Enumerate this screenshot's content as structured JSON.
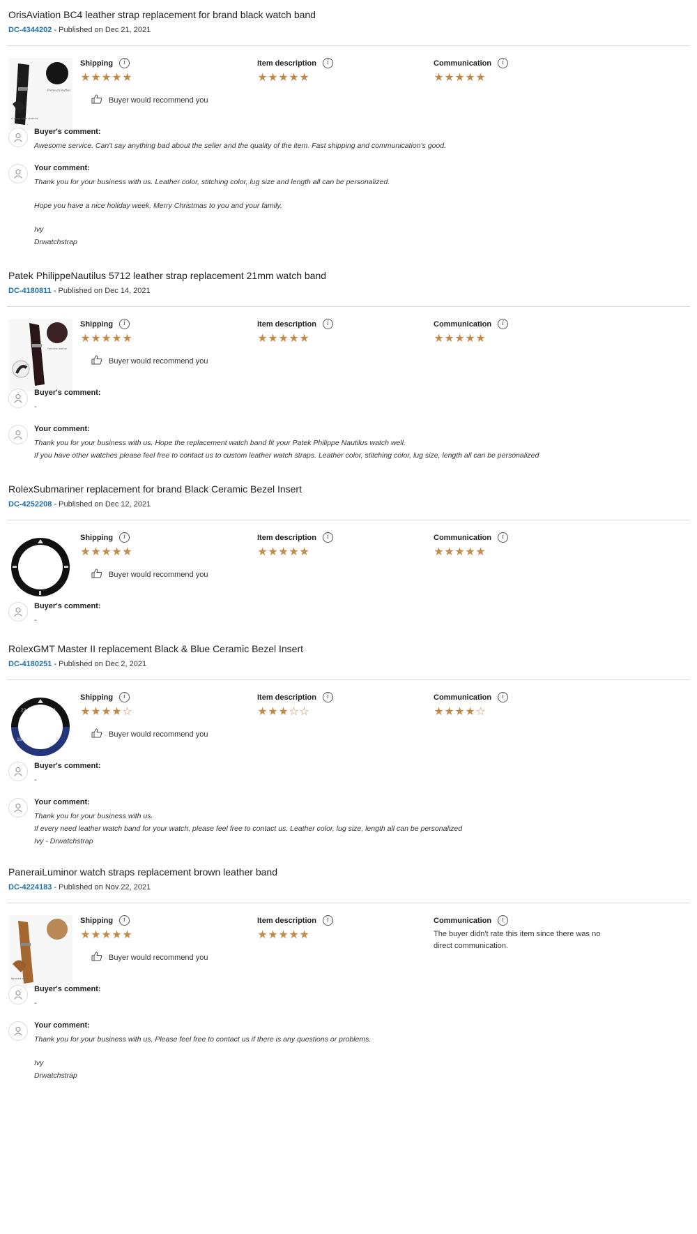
{
  "labels": {
    "shipping": "Shipping",
    "item_description": "Item description",
    "communication": "Communication",
    "buyer_recommend": "Buyer would recommend you",
    "buyer_comment": "Buyer's comment:",
    "your_comment": "Your comment:",
    "published_prefix": " - Published on "
  },
  "colors": {
    "star": "#c48a4a",
    "order_id": "#1f6fa8"
  },
  "reviews": [
    {
      "title": "OrisAviation BC4 leather strap replacement for brand black watch band",
      "order_id": "DC-4344202",
      "date": "Dec 21, 2021",
      "thumbnail": "black-leather-strap-image",
      "ratings": {
        "shipping": 5,
        "item_description": 5,
        "communication": 5
      },
      "buyer_comment": "Awesome service. Can't say anything bad about the seller and the quality of the item. Fast shipping and communication's good.",
      "your_comment": [
        "Thank you for your business with us. Leather color, stitching color, lug size and length all can be personalized.",
        "",
        "Hope you have a nice holiday week. Merry Christmas to you and your family.",
        "",
        "Ivy",
        "Drwatchstrap"
      ]
    },
    {
      "title": "Patek PhilippeNautilus 5712 leather strap replacement 21mm watch band",
      "order_id": "DC-4180811",
      "date": "Dec 14, 2021",
      "thumbnail": "dark-brown-leather-strap-image",
      "ratings": {
        "shipping": 5,
        "item_description": 5,
        "communication": 5
      },
      "buyer_comment": "-",
      "your_comment": [
        "Thank you for your business with us. Hope the replacement watch band fit your Patek Philippe Nautilus watch well.",
        "If you have other watches please feel free to contact us to custom leather watch straps. Leather color, stitching color, lug size, length all can be personalized"
      ]
    },
    {
      "title": "RolexSubmariner replacement for brand Black Ceramic Bezel Insert",
      "order_id": "DC-4252208",
      "date": "Dec 12, 2021",
      "thumbnail": "black-ceramic-bezel-image",
      "ratings": {
        "shipping": 5,
        "item_description": 5,
        "communication": 5
      },
      "buyer_comment": "-",
      "your_comment": null
    },
    {
      "title": "RolexGMT Master II replacement Black & Blue Ceramic Bezel Insert",
      "order_id": "DC-4180251",
      "date": "Dec 2, 2021",
      "thumbnail": "black-blue-bezel-image",
      "ratings": {
        "shipping": 4,
        "item_description": 3,
        "communication": 4
      },
      "buyer_comment": "-",
      "your_comment": [
        "Thank you for your business with us.",
        "If every need leather watch band for your watch, please feel free to contact us. Leather color, lug size, length all can be personalized",
        "Ivy - Drwatchstrap"
      ]
    },
    {
      "title": "PaneraiLuminor watch straps replacement brown leather band",
      "order_id": "DC-4224183",
      "date": "Nov 22, 2021",
      "thumbnail": "brown-leather-strap-image",
      "ratings": {
        "shipping": 5,
        "item_description": 5,
        "communication": null
      },
      "communication_note": "The buyer didn't rate this item since there was no direct communication.",
      "buyer_comment": "-",
      "your_comment": [
        "Thank you for your business with us. Please feel free to contact us if there is any questions or problems.",
        "",
        "Ivy",
        "Drwatchstrap"
      ]
    }
  ]
}
